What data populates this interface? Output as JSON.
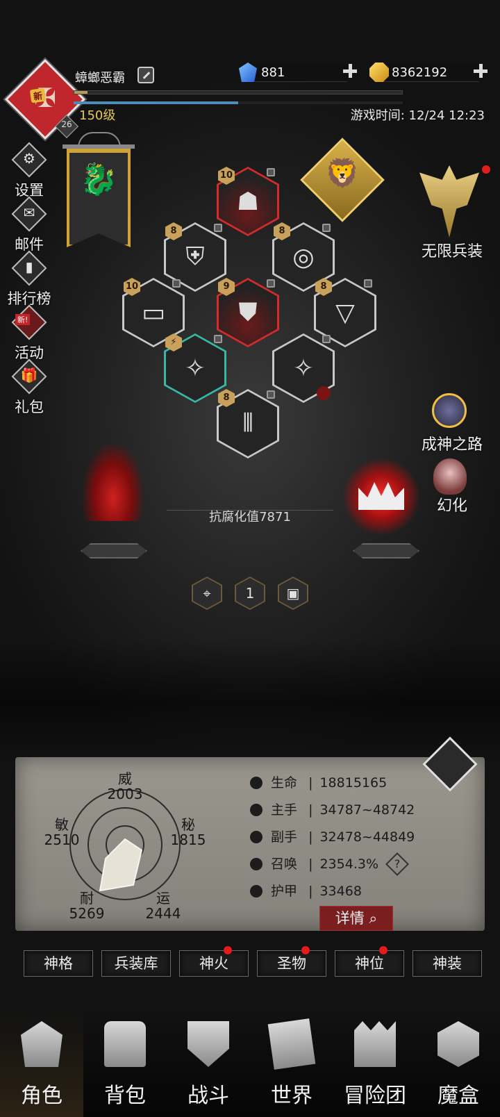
{
  "header": {
    "player_name": "蟑螂恶霸",
    "avatar_tag": "新",
    "avatar_level": "26",
    "level_label": "150级",
    "game_time": "游戏时间: 12/24 12:23",
    "xp_progress": 0.04,
    "hp_progress": 0.5,
    "gems": "881",
    "gold": "8362192"
  },
  "side_menu": [
    {
      "label": "设置",
      "icon": "gear-icon",
      "glyph": "⚙"
    },
    {
      "label": "邮件",
      "icon": "mail-icon",
      "glyph": "✉"
    },
    {
      "label": "排行榜",
      "icon": "ranking-icon",
      "glyph": "▮"
    },
    {
      "label": "活动",
      "icon": "event-icon",
      "glyph": "✦",
      "tag": "新!"
    },
    {
      "label": "礼包",
      "icon": "gift-icon",
      "glyph": "🎁"
    }
  ],
  "right_menu": {
    "infinite": "无限兵装",
    "god_path": "成神之路",
    "illusion": "幻化"
  },
  "equipment": [
    {
      "slot": "helmet",
      "level": "10",
      "glyph": "☗"
    },
    {
      "slot": "shoulder",
      "level": "8",
      "glyph": "⛨"
    },
    {
      "slot": "ring",
      "level": "8",
      "glyph": "◎"
    },
    {
      "slot": "belt",
      "level": "10",
      "glyph": "▭"
    },
    {
      "slot": "chest",
      "level": "9",
      "glyph": "⛊"
    },
    {
      "slot": "cloak",
      "level": "8",
      "glyph": "▽"
    },
    {
      "slot": "main-weapon",
      "level": "⚡",
      "glyph": "✧"
    },
    {
      "slot": "off-weapon",
      "level": "",
      "glyph": "✧"
    },
    {
      "slot": "boots",
      "level": "8",
      "glyph": "⫴"
    }
  ],
  "corruption": "抗腐化值7871",
  "page_selector": [
    "",
    "1",
    ""
  ],
  "radar": {
    "top": {
      "name": "威",
      "value": "2003"
    },
    "left": {
      "name": "敏",
      "value": "2510"
    },
    "right": {
      "name": "秘",
      "value": "1815"
    },
    "bottom_left": {
      "name": "耐",
      "value": "5269"
    },
    "bottom_right": {
      "name": "运",
      "value": "2444"
    }
  },
  "stats": [
    {
      "name": "生命",
      "value": "18815165",
      "icon": "heart-icon"
    },
    {
      "name": "主手",
      "value": "34787~48742",
      "icon": "main-hand-icon"
    },
    {
      "name": "副手",
      "value": "32478~44849",
      "icon": "off-hand-icon"
    },
    {
      "name": "召唤",
      "value": "2354.3%",
      "icon": "summon-icon"
    },
    {
      "name": "护甲",
      "value": "33468",
      "icon": "armor-icon"
    }
  ],
  "stat_separator": "|",
  "detail_button": "详情",
  "help_glyph": "?",
  "tabs": [
    {
      "label": "神格",
      "dot": false
    },
    {
      "label": "兵装库",
      "dot": false
    },
    {
      "label": "神火",
      "dot": true
    },
    {
      "label": "圣物",
      "dot": true
    },
    {
      "label": "神位",
      "dot": true
    },
    {
      "label": "神装",
      "dot": false
    }
  ],
  "bottom_nav": [
    {
      "label": "角色",
      "icon": "character-icon",
      "active": true
    },
    {
      "label": "背包",
      "icon": "backpack-icon",
      "active": false
    },
    {
      "label": "战斗",
      "icon": "battle-icon",
      "active": false
    },
    {
      "label": "世界",
      "icon": "world-icon",
      "active": false
    },
    {
      "label": "冒险团",
      "icon": "adventure-guild-icon",
      "active": false
    },
    {
      "label": "魔盒",
      "icon": "magic-box-icon",
      "active": false
    }
  ],
  "colors": {
    "accent_gold": "#e9c84a",
    "alert_red": "#e01c1c",
    "panel_paper": "#9a978f"
  }
}
